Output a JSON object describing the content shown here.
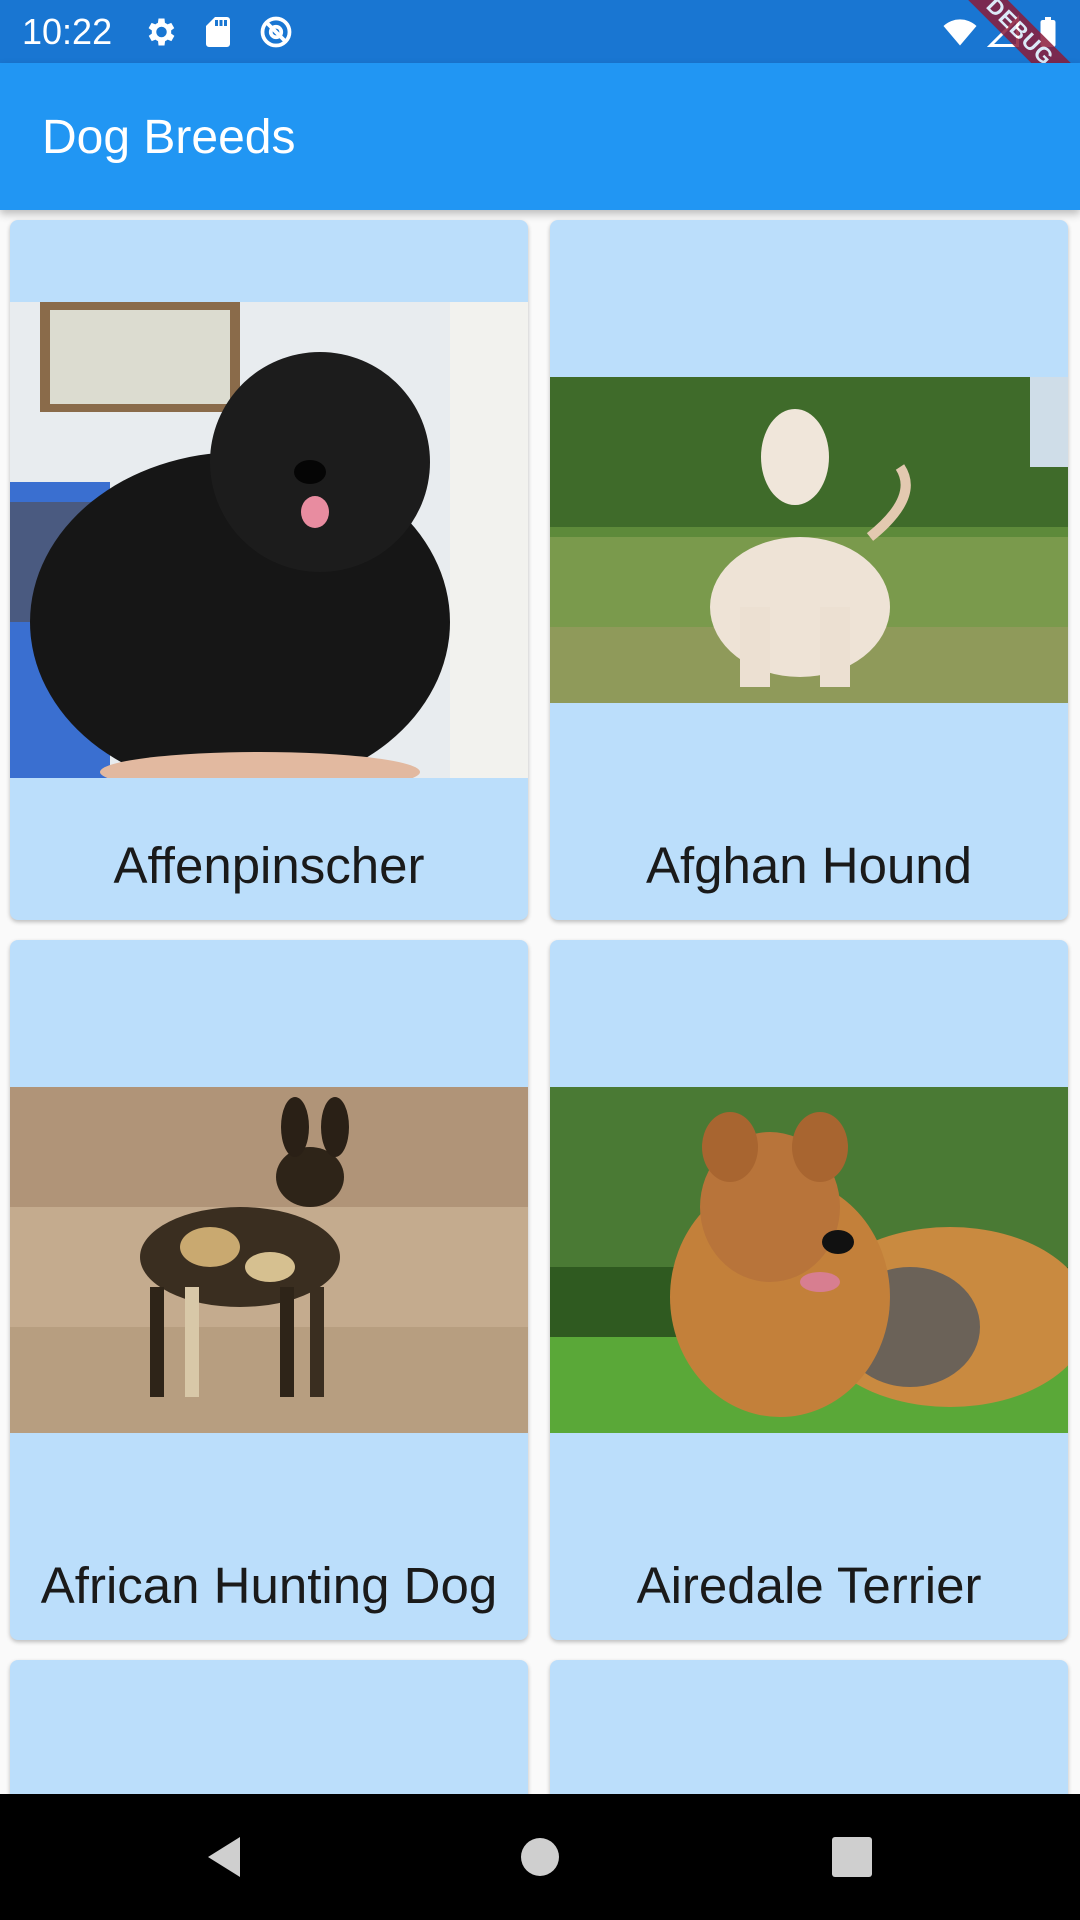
{
  "status_bar": {
    "time": "10:22",
    "left_icons": [
      "gear-icon",
      "sd-card-icon",
      "at-sign-icon"
    ],
    "right_icons": [
      "wifi-icon",
      "signal-icon",
      "battery-icon"
    ]
  },
  "app_bar": {
    "title": "Dog Breeds",
    "color": "#2196f3"
  },
  "debug_banner": "DEBUG",
  "breeds": [
    {
      "name": "Affenpinscher",
      "photo": "black-fluffy-dog-photo"
    },
    {
      "name": "Afghan Hound",
      "photo": "cream-long-haired-dog-photo"
    },
    {
      "name": "African Hunting Dog",
      "photo": "spotted-wild-dog-photo"
    },
    {
      "name": "Airedale Terrier",
      "photo": "tan-terrier-lying-photo"
    }
  ],
  "nav_bar": {
    "buttons": [
      "back-icon",
      "home-icon",
      "recents-icon"
    ]
  },
  "colors": {
    "card_background": "#bbdefb",
    "status_bar": "#1976d2"
  }
}
